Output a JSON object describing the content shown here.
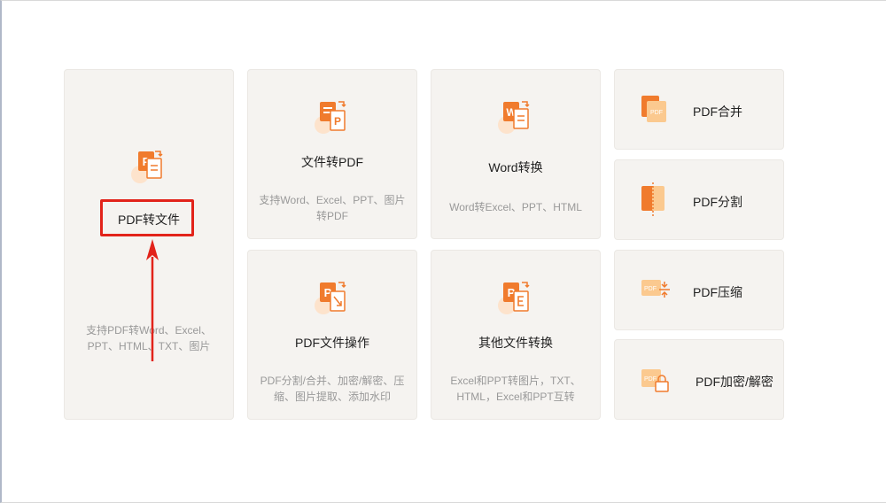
{
  "cards": {
    "pdf_to_file": {
      "title": "PDF转文件",
      "desc": "支持PDF转Word、Excel、PPT、HTML、TXT、图片"
    },
    "file_to_pdf": {
      "title": "文件转PDF",
      "desc": "支持Word、Excel、PPT、图片转PDF"
    },
    "word_convert": {
      "title": "Word转换",
      "desc": "Word转Excel、PPT、HTML"
    },
    "pdf_operations": {
      "title": "PDF文件操作",
      "desc": "PDF分割/合并、加密/解密、压缩、图片提取、添加水印"
    },
    "other_convert": {
      "title": "其他文件转换",
      "desc": "Excel和PPT转图片，TXT、HTML，Excel和PPT互转"
    },
    "pdf_merge": {
      "title": "PDF合并"
    },
    "pdf_split": {
      "title": "PDF分割"
    },
    "pdf_compress": {
      "title": "PDF压缩"
    },
    "pdf_encrypt": {
      "title": "PDF加密/解密"
    }
  },
  "icon_text": {
    "p": "P",
    "w": "W",
    "pdf": "PDF"
  },
  "colors": {
    "accent": "#f07b2d",
    "accent_light": "#fbd9b8",
    "highlight": "#e2231a",
    "card_bg": "#f5f3f0"
  }
}
